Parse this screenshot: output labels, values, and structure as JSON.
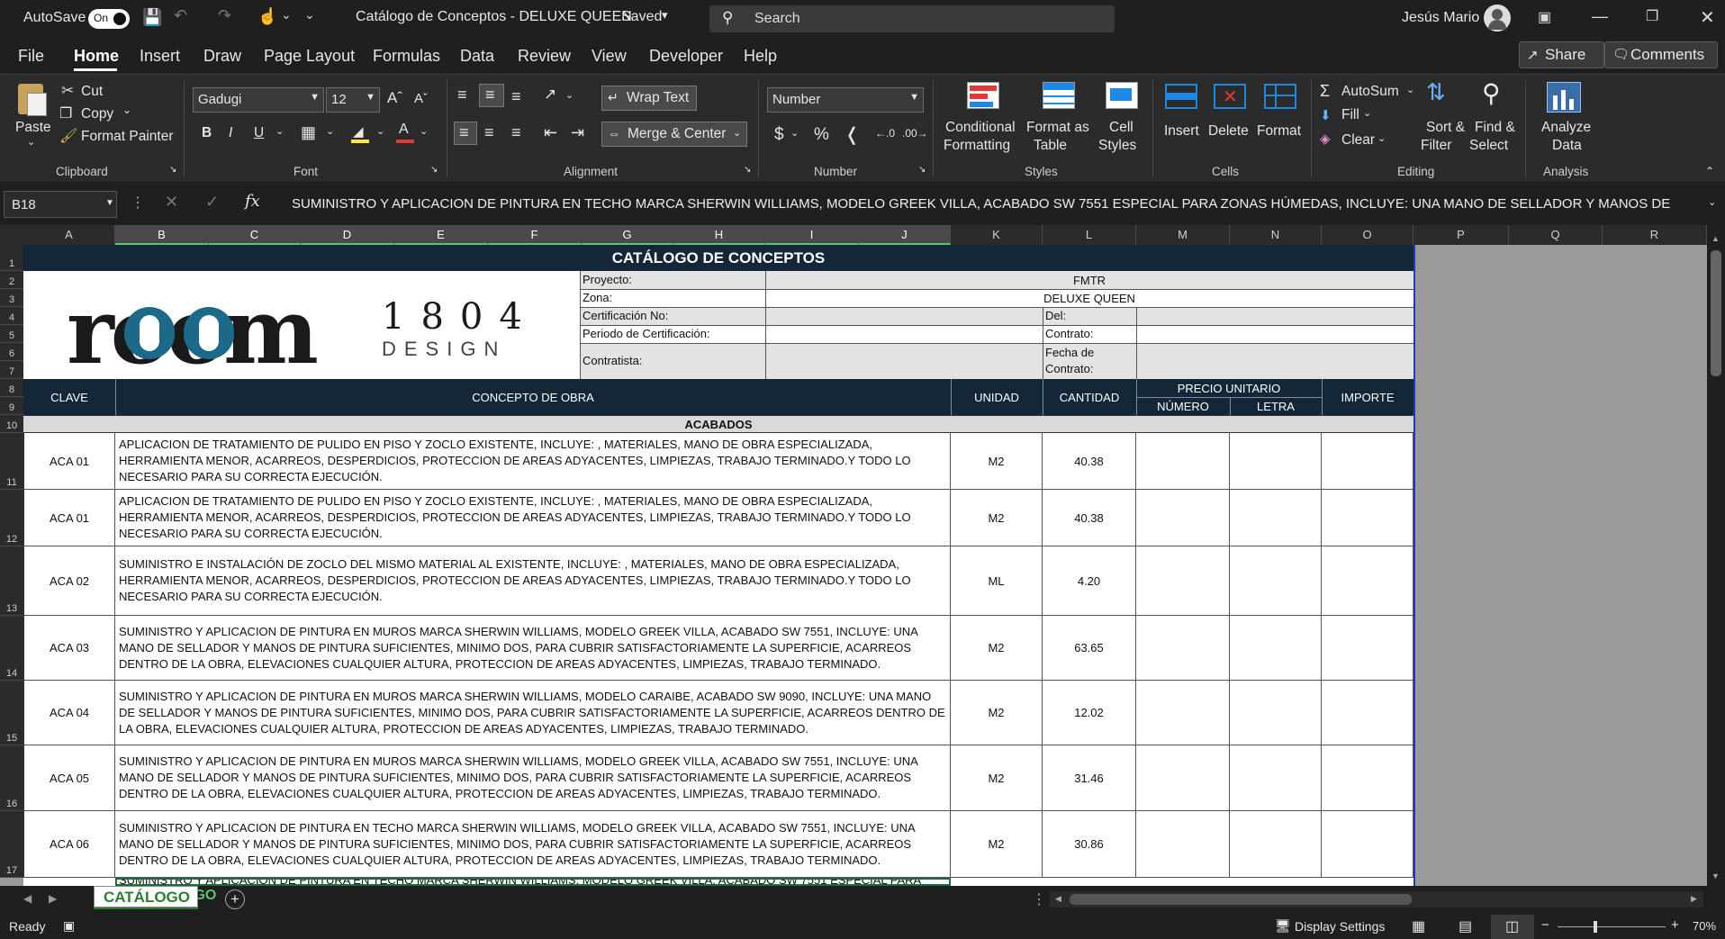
{
  "titlebar": {
    "autosave_label": "AutoSave",
    "autosave_state": "On",
    "doc_title": "Catálogo de Conceptos - DELUXE QUEEN",
    "saved": "Saved",
    "search_placeholder": "Search",
    "user": "Jesús Mario"
  },
  "menu": [
    "File",
    "Home",
    "Insert",
    "Draw",
    "Page Layout",
    "Formulas",
    "Data",
    "Review",
    "View",
    "Developer",
    "Help"
  ],
  "share_label": "Share",
  "comments_label": "Comments",
  "ribbon": {
    "clipboard": {
      "paste": "Paste",
      "cut": "Cut",
      "copy": "Copy",
      "format_painter": "Format Painter",
      "group": "Clipboard"
    },
    "font": {
      "name": "Gadugi",
      "size": "12",
      "group": "Font"
    },
    "alignment": {
      "wrap": "Wrap Text",
      "merge": "Merge & Center",
      "group": "Alignment"
    },
    "number": {
      "format": "Number",
      "group": "Number"
    },
    "styles": {
      "cond1": "Conditional",
      "cond2": "Formatting",
      "fmt1": "Format as",
      "fmt2": "Table",
      "cell1": "Cell",
      "cell2": "Styles",
      "group": "Styles"
    },
    "cells": {
      "insert": "Insert",
      "delete": "Delete",
      "format": "Format",
      "group": "Cells"
    },
    "editing": {
      "autosum": "AutoSum",
      "fill": "Fill",
      "clear": "Clear",
      "sort1": "Sort &",
      "sort2": "Filter",
      "find1": "Find &",
      "find2": "Select",
      "group": "Editing"
    },
    "analysis": {
      "a1": "Analyze",
      "a2": "Data",
      "group": "Analysis"
    }
  },
  "namebox": "B18",
  "formula": "SUMINISTRO Y APLICACION DE PINTURA EN TECHO MARCA SHERWIN WILLIAMS, MODELO GREEK VILLA, ACABADO SW 7551 ESPECIAL PARA ZONAS HÚMEDAS, INCLUYE: UNA MANO DE SELLADOR Y MANOS DE",
  "columns": [
    "A",
    "B",
    "C",
    "D",
    "E",
    "F",
    "G",
    "H",
    "I",
    "J",
    "K",
    "L",
    "M",
    "N",
    "O",
    "P",
    "Q",
    "R"
  ],
  "rows": [
    "1",
    "2",
    "3",
    "4",
    "5",
    "6",
    "7",
    "8",
    "9",
    "10",
    "11",
    "12",
    "13",
    "14",
    "15",
    "16",
    "17"
  ],
  "sheet": {
    "title": "CATÁLOGO DE CONCEPTOS",
    "logo_text": "room",
    "logo_num": "1804",
    "logo_sub": "DESIGN",
    "info": {
      "proyecto": "Proyecto:",
      "proyecto_val": "FMTR",
      "zona": "Zona:",
      "zona_val": "DELUXE QUEEN",
      "cert": "Certificación No:",
      "del": "Del:",
      "periodo": "Periodo de Certificación:",
      "contrato": "Contrato:",
      "contratista": "Contratista:",
      "fecha": "Fecha de Contrato:"
    },
    "headers": {
      "clave": "CLAVE",
      "concepto": "CONCEPTO DE OBRA",
      "unidad": "UNIDAD",
      "cantidad": "CANTIDAD",
      "pu": "PRECIO UNITARIO",
      "numero": "NÚMERO",
      "letra": "LETRA",
      "importe": "IMPORTE"
    },
    "section": "ACABADOS",
    "items": [
      {
        "clave": "ACA 01",
        "concepto": "APLICACION DE TRATAMIENTO DE PULIDO EN PISO Y ZOCLO EXISTENTE, INCLUYE: , MATERIALES, MANO DE OBRA ESPECIALIZADA, HERRAMIENTA MENOR, ACARREOS, DESPERDICIOS, PROTECCION DE AREAS ADYACENTES, LIMPIEZAS, TRABAJO TERMINADO.Y TODO LO NECESARIO PARA SU CORRECTA EJECUCIÓN.",
        "unidad": "M2",
        "cantidad": "40.38"
      },
      {
        "clave": "ACA 01",
        "concepto": "APLICACION DE TRATAMIENTO DE PULIDO EN PISO Y ZOCLO EXISTENTE, INCLUYE: , MATERIALES, MANO DE OBRA ESPECIALIZADA, HERRAMIENTA MENOR, ACARREOS, DESPERDICIOS, PROTECCION DE AREAS ADYACENTES, LIMPIEZAS, TRABAJO TERMINADO.Y TODO LO NECESARIO PARA SU CORRECTA EJECUCIÓN.",
        "unidad": "M2",
        "cantidad": "40.38"
      },
      {
        "clave": "ACA 02",
        "concepto": "SUMINISTRO E INSTALACIÓN DE ZOCLO DEL MISMO MATERIAL AL EXISTENTE, INCLUYE: , MATERIALES, MANO DE OBRA ESPECIALIZADA, HERRAMIENTA MENOR, ACARREOS, DESPERDICIOS, PROTECCION DE AREAS ADYACENTES, LIMPIEZAS, TRABAJO TERMINADO.Y TODO LO NECESARIO PARA SU CORRECTA EJECUCIÓN.",
        "unidad": "ML",
        "cantidad": "4.20"
      },
      {
        "clave": "ACA 03",
        "concepto": "SUMINISTRO Y APLICACION DE PINTURA EN MUROS MARCA SHERWIN WILLIAMS, MODELO GREEK VILLA, ACABADO SW 7551, INCLUYE: UNA MANO DE SELLADOR Y MANOS DE PINTURA SUFICIENTES, MINIMO DOS,  PARA CUBRIR SATISFACTORIAMENTE LA SUPERFICIE, ACARREOS DENTRO DE LA OBRA, ELEVACIONES CUALQUIER ALTURA, PROTECCION DE AREAS ADYACENTES, LIMPIEZAS, TRABAJO TERMINADO.",
        "unidad": "M2",
        "cantidad": "63.65"
      },
      {
        "clave": "ACA 04",
        "concepto": "SUMINISTRO Y APLICACION DE PINTURA EN MUROS MARCA SHERWIN WILLIAMS, MODELO CARAIBE, ACABADO SW 9090, INCLUYE: UNA MANO DE SELLADOR Y MANOS DE PINTURA SUFICIENTES, MINIMO DOS,  PARA CUBRIR SATISFACTORIAMENTE LA SUPERFICIE, ACARREOS DENTRO DE LA OBRA, ELEVACIONES CUALQUIER ALTURA, PROTECCION DE AREAS ADYACENTES, LIMPIEZAS, TRABAJO TERMINADO.",
        "unidad": "M2",
        "cantidad": "12.02"
      },
      {
        "clave": "ACA 05",
        "concepto": "SUMINISTRO Y APLICACION DE PINTURA EN MUROS MARCA SHERWIN WILLIAMS, MODELO GREEK VILLA, ACABADO SW 7551, INCLUYE: UNA MANO DE SELLADOR Y MANOS DE PINTURA SUFICIENTES, MINIMO DOS,  PARA CUBRIR SATISFACTORIAMENTE LA SUPERFICIE, ACARREOS DENTRO DE LA OBRA, ELEVACIONES CUALQUIER ALTURA, PROTECCION DE AREAS ADYACENTES, LIMPIEZAS, TRABAJO TERMINADO.",
        "unidad": "M2",
        "cantidad": "31.46"
      },
      {
        "clave": "ACA 06",
        "concepto": "SUMINISTRO Y APLICACION DE PINTURA EN TECHO MARCA SHERWIN WILLIAMS, MODELO GREEK VILLA, ACABADO SW 7551, INCLUYE: UNA MANO DE SELLADOR Y MANOS DE PINTURA SUFICIENTES, MINIMO DOS,  PARA CUBRIR SATISFACTORIAMENTE LA SUPERFICIE, ACARREOS DENTRO DE LA OBRA, ELEVACIONES CUALQUIER ALTURA, PROTECCION DE AREAS ADYACENTES, LIMPIEZAS, TRABAJO TERMINADO.",
        "unidad": "M2",
        "cantidad": "30.86"
      }
    ],
    "partial_row": "SUMINISTRO Y APLICACION DE PINTURA EN TECHO MARCA SHERWIN WILLIAMS, MODELO GREEK VILLA, ACABADO SW 7551 ESPECIAL PARA"
  },
  "tab": "CATÁLOGO",
  "status": {
    "ready": "Ready",
    "display": "Display Settings",
    "zoom": "70%"
  },
  "colors": {
    "accent_tab": "#2e7d32",
    "header_navy": "#132739",
    "logo_teal": "#1c6a8a"
  }
}
